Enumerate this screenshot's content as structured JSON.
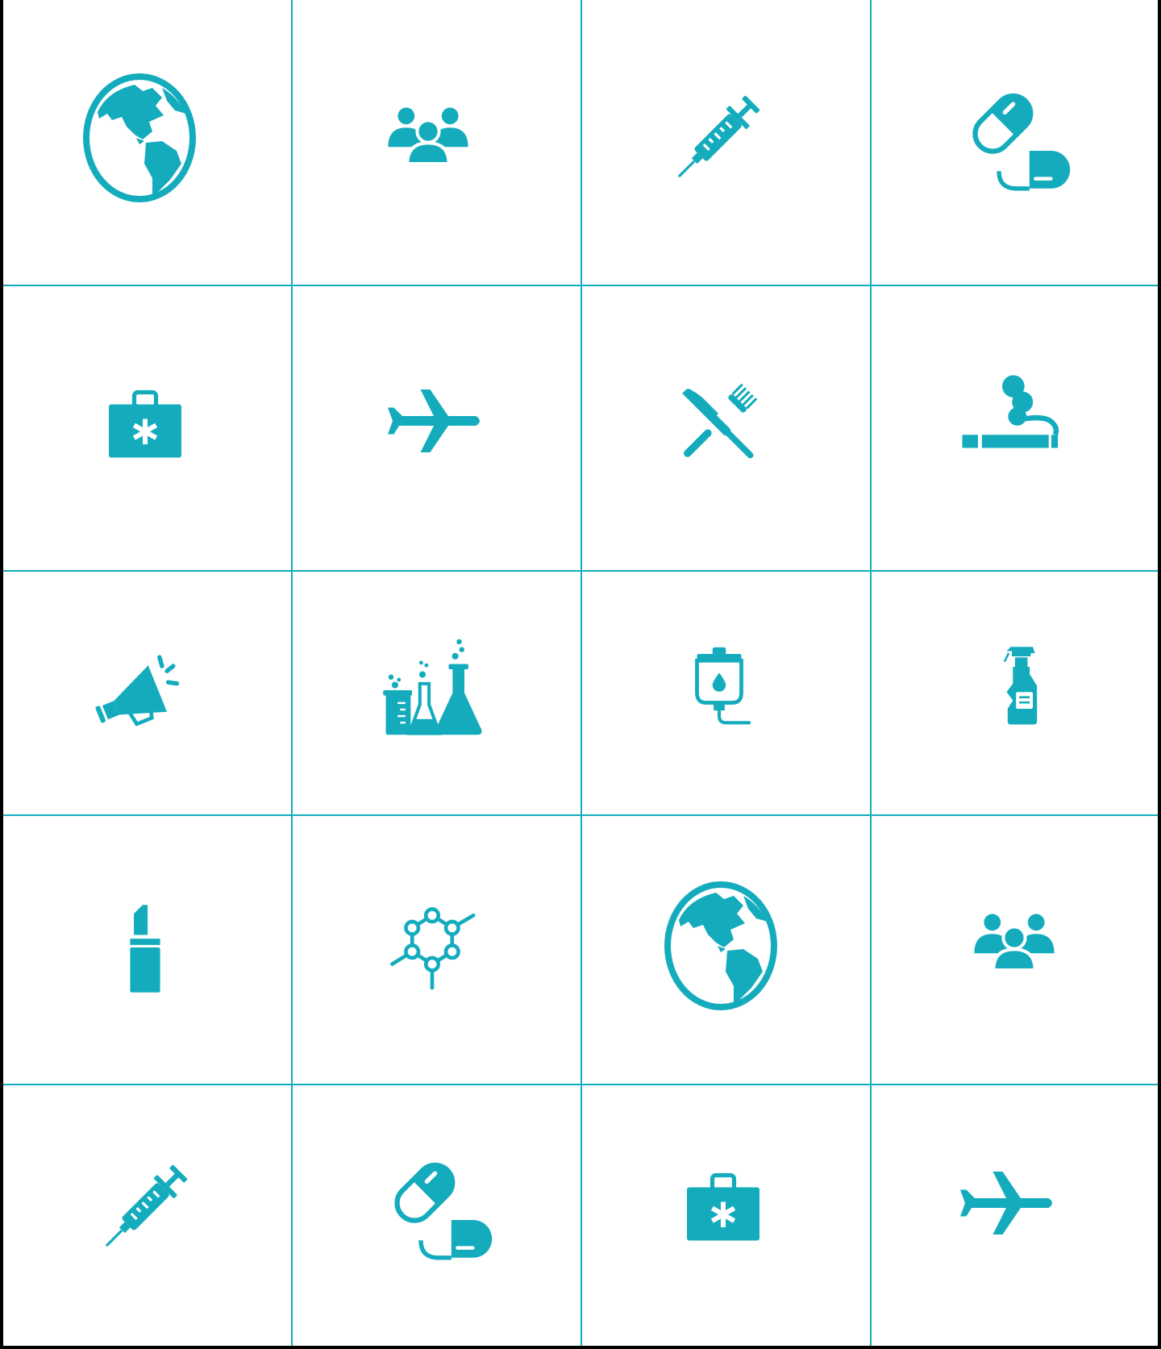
{
  "colors": {
    "icon": "#14acbd",
    "grid": "#14acbd",
    "background": "#ffffff",
    "frame": "#000000"
  },
  "grid": {
    "columns": 4,
    "rows": 5,
    "icons": [
      "globe-icon",
      "people-group-icon",
      "syringe-icon",
      "capsules-icon",
      "first-aid-kit-icon",
      "airplane-icon",
      "fork-knife-icon",
      "cigarette-smoking-icon",
      "megaphone-icon",
      "lab-flasks-icon",
      "iv-drip-bag-icon",
      "spray-bottle-icon",
      "lipstick-icon",
      "molecule-icon",
      "globe-icon",
      "people-group-icon",
      "syringe-icon",
      "capsules-icon",
      "first-aid-kit-icon",
      "airplane-icon"
    ]
  }
}
